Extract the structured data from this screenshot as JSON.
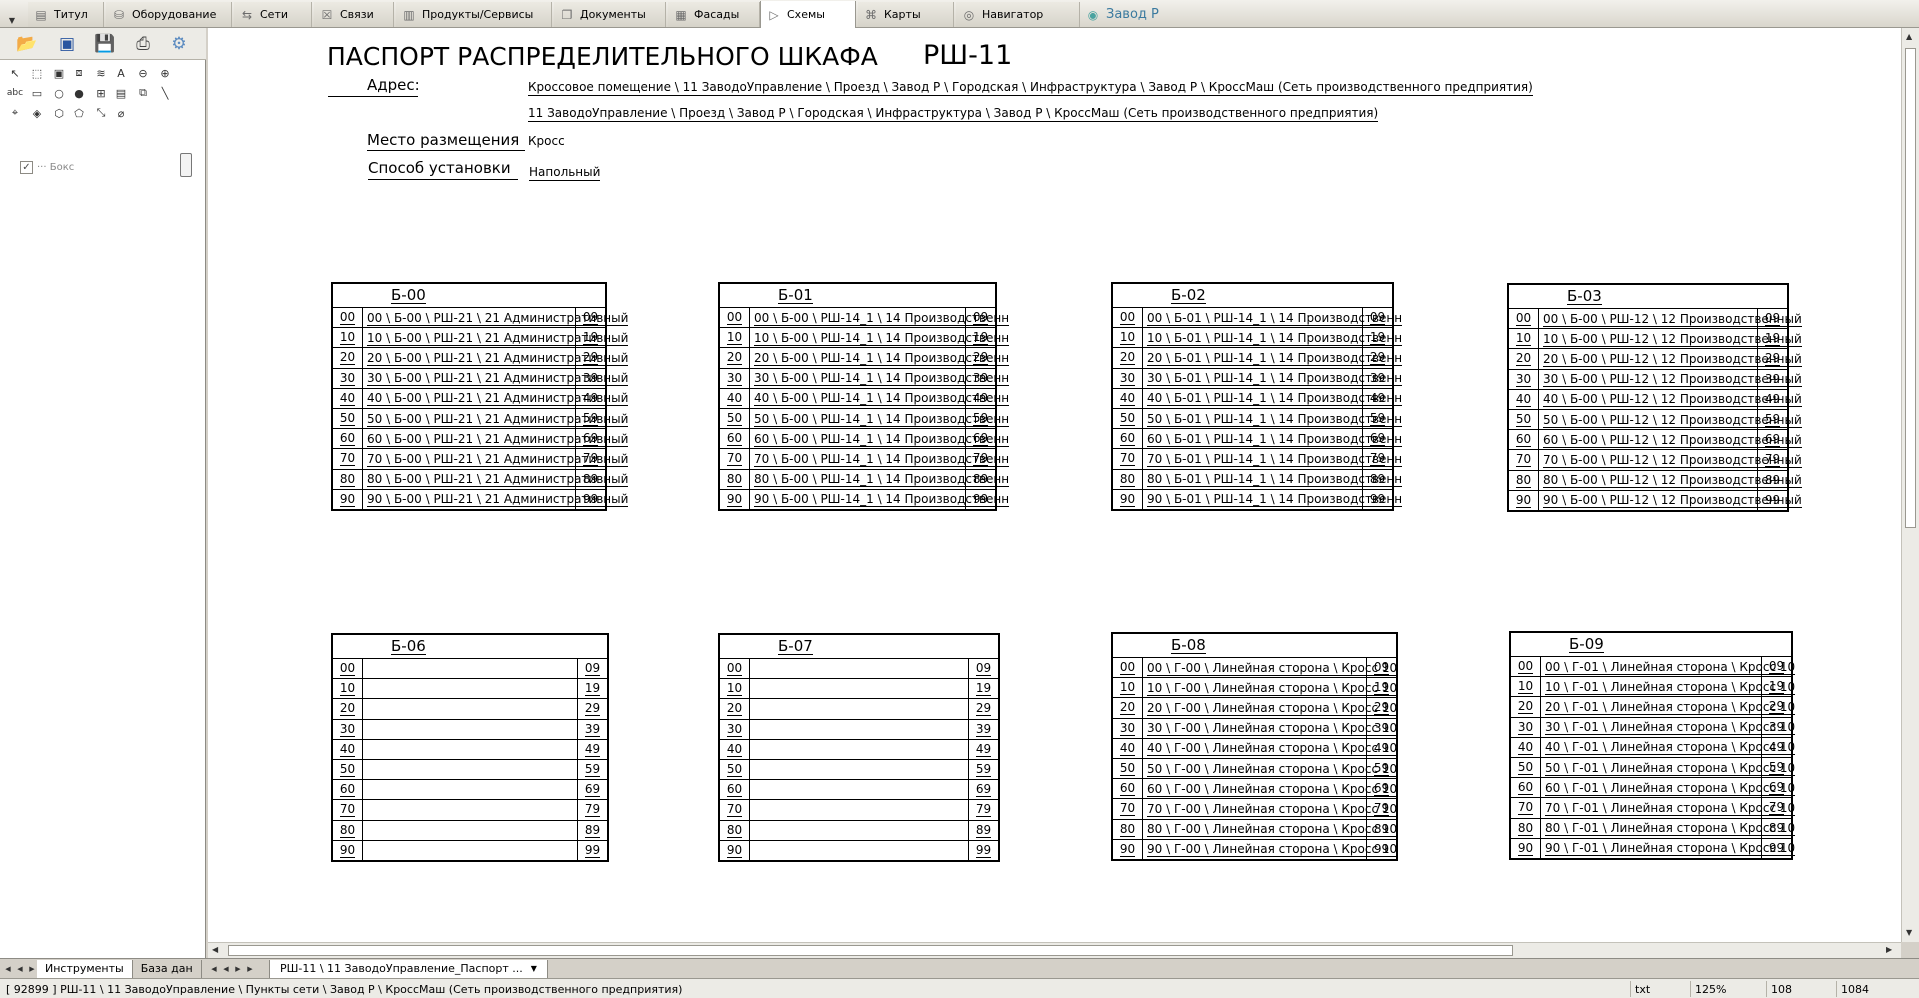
{
  "app": {
    "tabs": [
      {
        "label": "Титул",
        "icon": "document-icon"
      },
      {
        "label": "Оборудование",
        "icon": "database-icon"
      },
      {
        "label": "Сети",
        "icon": "network-icon"
      },
      {
        "label": "Связи",
        "icon": "links-icon"
      },
      {
        "label": "Продукты/Сервисы",
        "icon": "products-icon"
      },
      {
        "label": "Документы",
        "icon": "documents-icon"
      },
      {
        "label": "Фасады",
        "icon": "facade-icon"
      },
      {
        "label": "Схемы",
        "icon": "scheme-icon"
      },
      {
        "label": "Карты",
        "icon": "map-icon"
      },
      {
        "label": "Навигатор",
        "icon": "navigator-icon"
      },
      {
        "label": "Завод Р",
        "icon": "globe-icon"
      }
    ],
    "active_tab": "Схемы",
    "tree_item": "··· Бокс",
    "left_tabs": [
      "Инструменты",
      "База дан"
    ],
    "doc_tab": "РШ-11 \\ 11 ЗаводоУправление_Паспорт ...",
    "status": {
      "path": "[ 92899 ] РШ-11 \\ 11 ЗаводоУправление \\ Пункты сети \\ Завод Р \\ КроссМаш (Сеть производственного предприятия)",
      "format": "txt",
      "zoom": "125%",
      "x": "108",
      "y": "1084"
    }
  },
  "doc": {
    "title": "ПАСПОРТ РАСПРЕДЕЛИТЕЛЬНОГО ШКАФА",
    "code": "РШ-11",
    "address_label": "Адрес:",
    "address_line1": "Кроссовое помещение \\ 11 ЗаводоУправление \\ Проезд \\ Завод Р \\ Городская \\ Инфраструктура \\ Завод Р \\ КроссМаш (Сеть производственного предприятия)",
    "address_line2": "11 ЗаводоУправление \\ Проезд \\ Завод Р \\ Городская \\ Инфраструктура \\ Завод Р \\ КроссМаш (Сеть производственного предприятия)",
    "place_label": "Место размещения",
    "place_value": "Кросс",
    "install_label": "Способ установки",
    "install_value": "Напольный"
  },
  "blocks": [
    {
      "name": "Б-00",
      "rows": [
        {
          "s": "00",
          "d": "00 \\ Б-00 \\ РШ-21 \\ 21 Административный",
          "e": "09"
        },
        {
          "s": "10",
          "d": "10 \\ Б-00 \\ РШ-21 \\ 21 Административный",
          "e": "19"
        },
        {
          "s": "20",
          "d": "20 \\ Б-00 \\ РШ-21 \\ 21 Административный",
          "e": "29"
        },
        {
          "s": "30",
          "d": "30 \\ Б-00 \\ РШ-21 \\ 21 Административный",
          "e": "39"
        },
        {
          "s": "40",
          "d": "40 \\ Б-00 \\ РШ-21 \\ 21 Административный",
          "e": "49"
        },
        {
          "s": "50",
          "d": "50 \\ Б-00 \\ РШ-21 \\ 21 Административный",
          "e": "59"
        },
        {
          "s": "60",
          "d": "60 \\ Б-00 \\ РШ-21 \\ 21 Административный",
          "e": "69"
        },
        {
          "s": "70",
          "d": "70 \\ Б-00 \\ РШ-21 \\ 21 Административный",
          "e": "79"
        },
        {
          "s": "80",
          "d": "80 \\ Б-00 \\ РШ-21 \\ 21 Административный",
          "e": "89"
        },
        {
          "s": "90",
          "d": "90 \\ Б-00 \\ РШ-21 \\ 21 Административный",
          "e": "99"
        }
      ]
    },
    {
      "name": "Б-01",
      "rows": [
        {
          "s": "00",
          "d": "00 \\ Б-00 \\ РШ-14_1 \\ 14 Производственн",
          "e": "09"
        },
        {
          "s": "10",
          "d": "10 \\ Б-00 \\ РШ-14_1 \\ 14 Производственн",
          "e": "19"
        },
        {
          "s": "20",
          "d": "20 \\ Б-00 \\ РШ-14_1 \\ 14 Производственн",
          "e": "29"
        },
        {
          "s": "30",
          "d": "30 \\ Б-00 \\ РШ-14_1 \\ 14 Производственн",
          "e": "39"
        },
        {
          "s": "40",
          "d": "40 \\ Б-00 \\ РШ-14_1 \\ 14 Производственн",
          "e": "49"
        },
        {
          "s": "50",
          "d": "50 \\ Б-00 \\ РШ-14_1 \\ 14 Производственн",
          "e": "59"
        },
        {
          "s": "60",
          "d": "60 \\ Б-00 \\ РШ-14_1 \\ 14 Производственн",
          "e": "69"
        },
        {
          "s": "70",
          "d": "70 \\ Б-00 \\ РШ-14_1 \\ 14 Производственн",
          "e": "79"
        },
        {
          "s": "80",
          "d": "80 \\ Б-00 \\ РШ-14_1 \\ 14 Производственн",
          "e": "89"
        },
        {
          "s": "90",
          "d": "90 \\ Б-00 \\ РШ-14_1 \\ 14 Производственн",
          "e": "99"
        }
      ]
    },
    {
      "name": "Б-02",
      "rows": [
        {
          "s": "00",
          "d": "00 \\ Б-01 \\ РШ-14_1 \\ 14 Производственн",
          "e": "09"
        },
        {
          "s": "10",
          "d": "10 \\ Б-01 \\ РШ-14_1 \\ 14 Производственн",
          "e": "19"
        },
        {
          "s": "20",
          "d": "20 \\ Б-01 \\ РШ-14_1 \\ 14 Производственн",
          "e": "29"
        },
        {
          "s": "30",
          "d": "30 \\ Б-01 \\ РШ-14_1 \\ 14 Производственн",
          "e": "39"
        },
        {
          "s": "40",
          "d": "40 \\ Б-01 \\ РШ-14_1 \\ 14 Производственн",
          "e": "49"
        },
        {
          "s": "50",
          "d": "50 \\ Б-01 \\ РШ-14_1 \\ 14 Производственн",
          "e": "59"
        },
        {
          "s": "60",
          "d": "60 \\ Б-01 \\ РШ-14_1 \\ 14 Производственн",
          "e": "69"
        },
        {
          "s": "70",
          "d": "70 \\ Б-01 \\ РШ-14_1 \\ 14 Производственн",
          "e": "79"
        },
        {
          "s": "80",
          "d": "80 \\ Б-01 \\ РШ-14_1 \\ 14 Производственн",
          "e": "89"
        },
        {
          "s": "90",
          "d": "90 \\ Б-01 \\ РШ-14_1 \\ 14 Производственн",
          "e": "99"
        }
      ]
    },
    {
      "name": "Б-03",
      "rows": [
        {
          "s": "00",
          "d": "00 \\ Б-00 \\ РШ-12 \\ 12 Производственный",
          "e": "09"
        },
        {
          "s": "10",
          "d": "10 \\ Б-00 \\ РШ-12 \\ 12 Производственный",
          "e": "19"
        },
        {
          "s": "20",
          "d": "20 \\ Б-00 \\ РШ-12 \\ 12 Производственный",
          "e": "29"
        },
        {
          "s": "30",
          "d": "30 \\ Б-00 \\ РШ-12 \\ 12 Производственный",
          "e": "39"
        },
        {
          "s": "40",
          "d": "40 \\ Б-00 \\ РШ-12 \\ 12 Производственный",
          "e": "49"
        },
        {
          "s": "50",
          "d": "50 \\ Б-00 \\ РШ-12 \\ 12 Производственный",
          "e": "59"
        },
        {
          "s": "60",
          "d": "60 \\ Б-00 \\ РШ-12 \\ 12 Производственный",
          "e": "69"
        },
        {
          "s": "70",
          "d": "70 \\ Б-00 \\ РШ-12 \\ 12 Производственный",
          "e": "79"
        },
        {
          "s": "80",
          "d": "80 \\ Б-00 \\ РШ-12 \\ 12 Производственный",
          "e": "89"
        },
        {
          "s": "90",
          "d": "90 \\ Б-00 \\ РШ-12 \\ 12 Производственный",
          "e": "99"
        }
      ]
    },
    {
      "name": "Б-06",
      "rows": [
        {
          "s": "00",
          "d": "",
          "e": "09"
        },
        {
          "s": "10",
          "d": "",
          "e": "19"
        },
        {
          "s": "20",
          "d": "",
          "e": "29"
        },
        {
          "s": "30",
          "d": "",
          "e": "39"
        },
        {
          "s": "40",
          "d": "",
          "e": "49"
        },
        {
          "s": "50",
          "d": "",
          "e": "59"
        },
        {
          "s": "60",
          "d": "",
          "e": "69"
        },
        {
          "s": "70",
          "d": "",
          "e": "79"
        },
        {
          "s": "80",
          "d": "",
          "e": "89"
        },
        {
          "s": "90",
          "d": "",
          "e": "99"
        }
      ]
    },
    {
      "name": "Б-07",
      "rows": [
        {
          "s": "00",
          "d": "",
          "e": "09"
        },
        {
          "s": "10",
          "d": "",
          "e": "19"
        },
        {
          "s": "20",
          "d": "",
          "e": "29"
        },
        {
          "s": "30",
          "d": "",
          "e": "39"
        },
        {
          "s": "40",
          "d": "",
          "e": "49"
        },
        {
          "s": "50",
          "d": "",
          "e": "59"
        },
        {
          "s": "60",
          "d": "",
          "e": "69"
        },
        {
          "s": "70",
          "d": "",
          "e": "79"
        },
        {
          "s": "80",
          "d": "",
          "e": "89"
        },
        {
          "s": "90",
          "d": "",
          "e": "99"
        }
      ]
    },
    {
      "name": "Б-08",
      "rows": [
        {
          "s": "00",
          "d": "00 \\ Г-00 \\ Линейная сторона \\ Кросс 10",
          "e": "09"
        },
        {
          "s": "10",
          "d": "10 \\ Г-00 \\ Линейная сторона \\ Кросс 10",
          "e": "19"
        },
        {
          "s": "20",
          "d": "20 \\ Г-00 \\ Линейная сторона \\ Кросс 10",
          "e": "29"
        },
        {
          "s": "30",
          "d": "30 \\ Г-00 \\ Линейная сторона \\ Кросс 10",
          "e": "39"
        },
        {
          "s": "40",
          "d": "40 \\ Г-00 \\ Линейная сторона \\ Кросс 10",
          "e": "49"
        },
        {
          "s": "50",
          "d": "50 \\ Г-00 \\ Линейная сторона \\ Кросс 10",
          "e": "59"
        },
        {
          "s": "60",
          "d": "60 \\ Г-00 \\ Линейная сторона \\ Кросс 10",
          "e": "69"
        },
        {
          "s": "70",
          "d": "70 \\ Г-00 \\ Линейная сторона \\ Кросс 10",
          "e": "79"
        },
        {
          "s": "80",
          "d": "80 \\ Г-00 \\ Линейная сторона \\ Кросс 10",
          "e": "89"
        },
        {
          "s": "90",
          "d": "90 \\ Г-00 \\ Линейная сторона \\ Кросс 10",
          "e": "99"
        }
      ]
    },
    {
      "name": "Б-09",
      "rows": [
        {
          "s": "00",
          "d": "00 \\ Г-01 \\ Линейная сторона \\ Кросс 10",
          "e": "09"
        },
        {
          "s": "10",
          "d": "10 \\ Г-01 \\ Линейная сторона \\ Кросс 10",
          "e": "19"
        },
        {
          "s": "20",
          "d": "20 \\ Г-01 \\ Линейная сторона \\ Кросс 10",
          "e": "29"
        },
        {
          "s": "30",
          "d": "30 \\ Г-01 \\ Линейная сторона \\ Кросс 10",
          "e": "39"
        },
        {
          "s": "40",
          "d": "40 \\ Г-01 \\ Линейная сторона \\ Кросс 10",
          "e": "49"
        },
        {
          "s": "50",
          "d": "50 \\ Г-01 \\ Линейная сторона \\ Кросс 10",
          "e": "59"
        },
        {
          "s": "60",
          "d": "60 \\ Г-01 \\ Линейная сторона \\ Кросс 10",
          "e": "69"
        },
        {
          "s": "70",
          "d": "70 \\ Г-01 \\ Линейная сторона \\ Кросс 10",
          "e": "79"
        },
        {
          "s": "80",
          "d": "80 \\ Г-01 \\ Линейная сторона \\ Кросс 10",
          "e": "89"
        },
        {
          "s": "90",
          "d": "90 \\ Г-01 \\ Линейная сторона \\ Кросс 10",
          "e": "99"
        }
      ]
    }
  ]
}
